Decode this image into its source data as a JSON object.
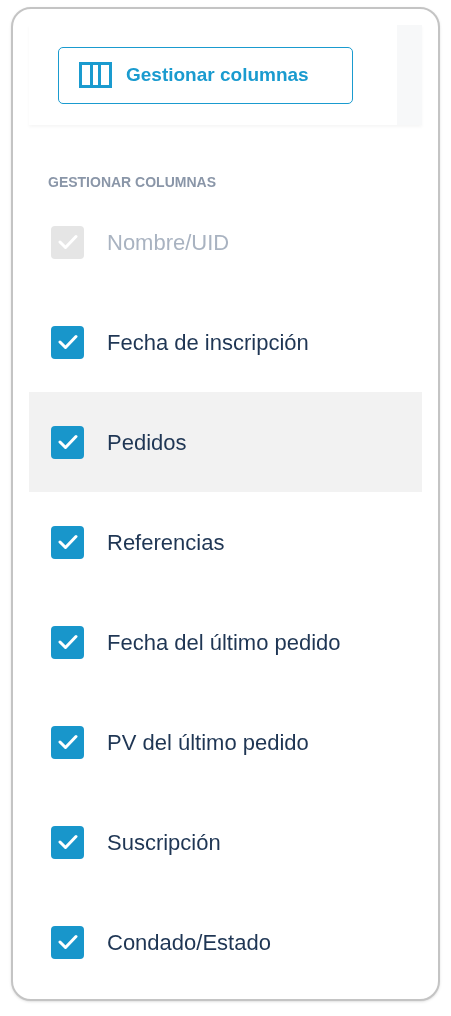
{
  "toolbar": {
    "button": {
      "label": "Gestionar columnas"
    }
  },
  "menu": {
    "heading": "GESTIONAR COLUMNAS",
    "items": [
      {
        "label": "Nombre/UID",
        "checked": true,
        "disabled": true,
        "hovered": false
      },
      {
        "label": "Fecha de inscripción",
        "checked": true,
        "disabled": false,
        "hovered": false
      },
      {
        "label": "Pedidos",
        "checked": true,
        "disabled": false,
        "hovered": true
      },
      {
        "label": "Referencias",
        "checked": true,
        "disabled": false,
        "hovered": false
      },
      {
        "label": "Fecha del último pedido",
        "checked": true,
        "disabled": false,
        "hovered": false
      },
      {
        "label": "PV del último pedido",
        "checked": true,
        "disabled": false,
        "hovered": false
      },
      {
        "label": "Suscripción",
        "checked": true,
        "disabled": false,
        "hovered": false
      },
      {
        "label": "Condado/Estado",
        "checked": true,
        "disabled": false,
        "hovered": false
      }
    ]
  }
}
